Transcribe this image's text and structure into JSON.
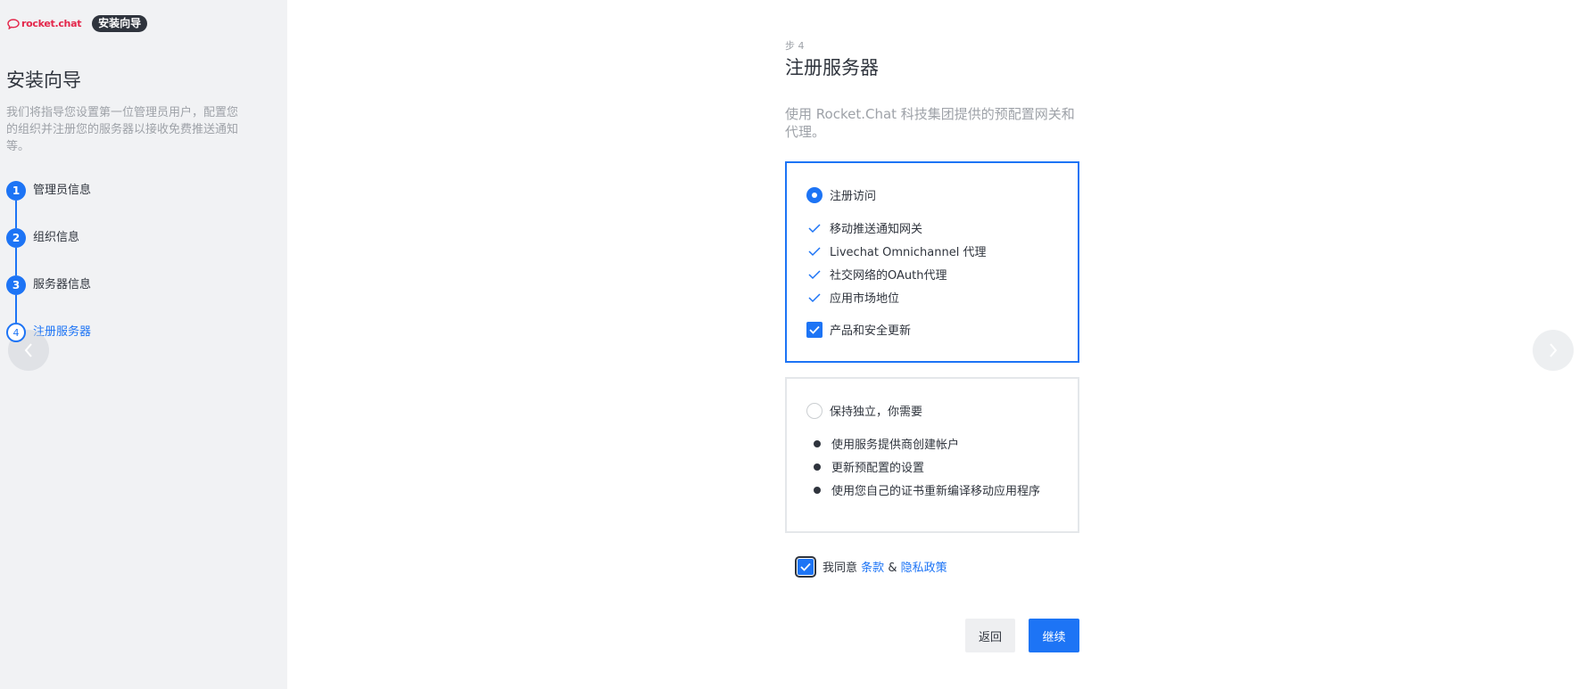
{
  "sidebar": {
    "logo_text": "rocket.chat",
    "badge": "安装向导",
    "title": "安装向导",
    "description": "我们将指导您设置第一位管理员用户，配置您的组织并注册您的服务器以接收免费推送通知等。",
    "steps": [
      {
        "num": "1",
        "label": "管理员信息"
      },
      {
        "num": "2",
        "label": "组织信息"
      },
      {
        "num": "3",
        "label": "服务器信息"
      },
      {
        "num": "4",
        "label": "注册服务器"
      }
    ]
  },
  "main": {
    "step_indicator": "步 4",
    "title": "注册服务器",
    "subtitle": "使用 Rocket.Chat 科技集团提供的预配置网关和代理。",
    "option_registered": {
      "label": "注册访问",
      "features": [
        "移动推送通知网关",
        "Livechat Omnichannel 代理",
        "社交网络的OAuth代理",
        "应用市场地位"
      ],
      "updates_label": "产品和安全更新"
    },
    "option_standalone": {
      "label": "保持独立，你需要",
      "items": [
        "使用服务提供商创建帐户",
        "更新预配置的设置",
        "使用您自己的证书重新编译移动应用程序"
      ]
    },
    "agree": {
      "prefix": "我同意",
      "terms": "条款",
      "amp": "&",
      "privacy": "隐私政策"
    },
    "buttons": {
      "back": "返回",
      "continue": "继续"
    }
  },
  "colors": {
    "accent": "#1d74f5",
    "sidebar_bg": "#f1f2f4",
    "logo": "#e4274b"
  }
}
